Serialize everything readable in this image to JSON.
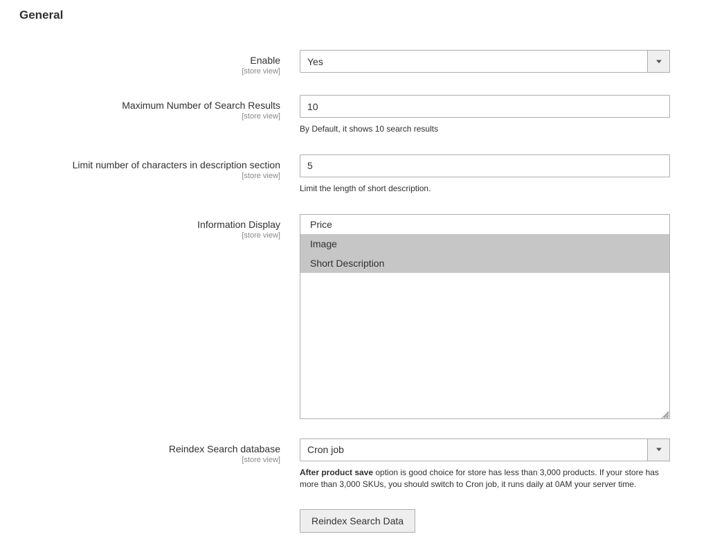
{
  "section": {
    "title": "General"
  },
  "scope_label": "[store view]",
  "fields": {
    "enable": {
      "label": "Enable",
      "value": "Yes"
    },
    "max_results": {
      "label": "Maximum Number of Search Results",
      "value": "10",
      "note": "By Default, it shows 10 search results"
    },
    "desc_limit": {
      "label": "Limit number of characters in description section",
      "value": "5",
      "note": "Limit the length of short description."
    },
    "info_display": {
      "label": "Information Display",
      "options": [
        {
          "text": "Price",
          "selected": false
        },
        {
          "text": "Image",
          "selected": true
        },
        {
          "text": "Short Description",
          "selected": true
        }
      ]
    },
    "reindex": {
      "label": "Reindex Search database",
      "value": "Cron job",
      "note_strong": "After product save",
      "note_rest": " option is good choice for store has less than 3,000 products. If your store has more than 3,000 SKUs, you should switch to Cron job, it runs daily at 0AM your server time."
    }
  },
  "buttons": {
    "reindex_data": "Reindex Search Data"
  }
}
